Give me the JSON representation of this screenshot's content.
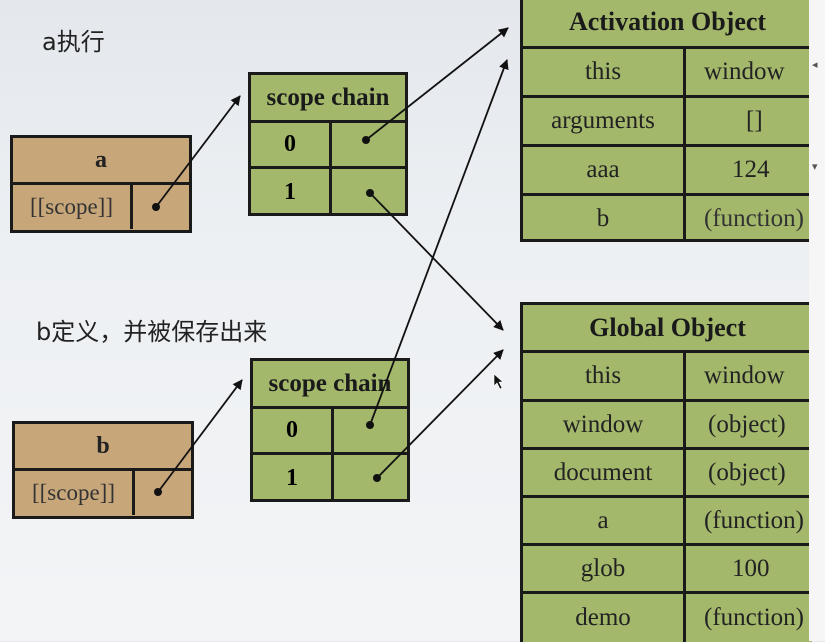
{
  "captions": {
    "a_exec": "a执行",
    "b_def": "b定义，并被保存出来"
  },
  "func_a": {
    "name": "a",
    "scope_label": "[[scope]]"
  },
  "func_b": {
    "name": "b",
    "scope_label": "[[scope]]"
  },
  "scope_chain_a": {
    "title": "scope chain",
    "indices": [
      "0",
      "1"
    ]
  },
  "scope_chain_b": {
    "title": "scope chain",
    "indices": [
      "0",
      "1"
    ]
  },
  "activation_object": {
    "title": "Activation Object",
    "rows": [
      {
        "key": "this",
        "value": "window"
      },
      {
        "key": "arguments",
        "value": "[]"
      },
      {
        "key": "aaa",
        "value": "124"
      },
      {
        "key": "b",
        "value": "(function)"
      }
    ]
  },
  "global_object": {
    "title": "Global Object",
    "rows": [
      {
        "key": "this",
        "value": "window"
      },
      {
        "key": "window",
        "value": "(object)"
      },
      {
        "key": "document",
        "value": "(object)"
      },
      {
        "key": "a",
        "value": "(function)"
      },
      {
        "key": "glob",
        "value": "100"
      },
      {
        "key": "demo",
        "value": "(function)"
      }
    ]
  },
  "colors": {
    "func_box": "#c7a67a",
    "object_box": "#a3b86b",
    "border": "#1a1a1a"
  }
}
